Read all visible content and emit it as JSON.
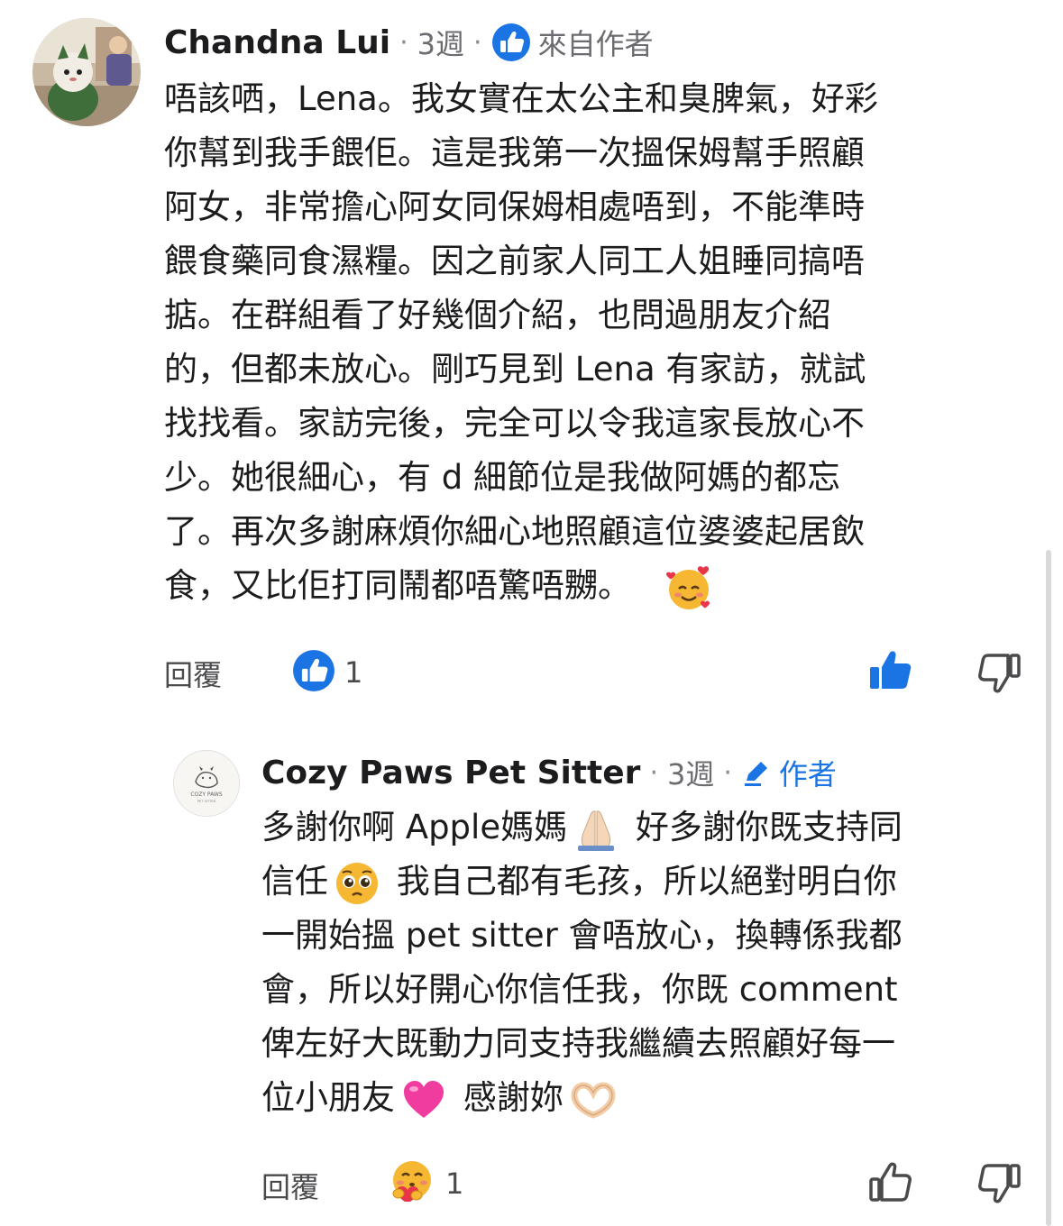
{
  "comment": {
    "author": "Chandna Lui",
    "time": "3週",
    "badge_label": "來自作者",
    "text_lines": [
      "唔該哂，Lena。我女實在太公主和臭脾氣，好彩",
      "你幫到我手餵佢。這是我第一次搵保姆幫手照顧",
      "阿女，非常擔心阿女同保姆相處唔到，不能準時",
      "餵食藥同食濕糧。因之前家人同工人姐睡同搞唔",
      "掂。在群組看了好幾個介紹，也問過朋友介紹",
      "的，但都未放心。剛巧見到 Lena 有家訪，就試",
      "找找看。家訪完後，完全可以令我這家長放心不",
      "少。她很細心，有 d 細節位是我做阿媽的都忘",
      "了。再次多謝麻煩你細心地照顧這位婆婆起居飲",
      "食，又比佢打同鬧都唔驚唔嬲。"
    ],
    "reply_label": "回覆",
    "reaction_count": "1",
    "reaction_icon": "like-icon",
    "trailing_emoji": "smiling-face-with-hearts"
  },
  "reply": {
    "author": "Cozy Paws Pet Sitter",
    "time": "3週",
    "badge_label": "作者",
    "avatar_text": "COZY PAWS",
    "avatar_subtext": "PET SITTER",
    "text_segments": [
      [
        "多謝你啊 Apple媽媽",
        "emoji:folded-hands",
        " 好多謝你既支持同"
      ],
      [
        "信任",
        "emoji:pleading-face",
        " 我自己都有毛孩，所以絕對明白你"
      ],
      [
        "一開始搵 pet sitter 會唔放心，換轉係我都"
      ],
      [
        "會，所以好開心你信任我，你既 comment"
      ],
      [
        "俾左好大既動力同支持我繼續去照顧好每一"
      ],
      [
        "位小朋友",
        "emoji:pink-heart",
        " 感謝妳",
        "emoji:heart-hands"
      ]
    ],
    "reply_label": "回覆",
    "reaction_count": "1",
    "reaction_icon": "hugging-face-icon"
  },
  "colors": {
    "accent": "#1b74e4",
    "text": "#1c1c1e",
    "muted": "#6c6c70"
  }
}
